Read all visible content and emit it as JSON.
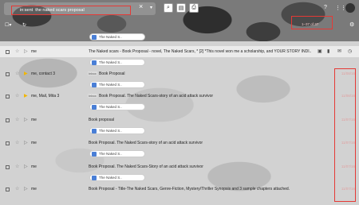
{
  "search": {
    "value": "in:sent  the naked scars proposal",
    "clear_icon": "close-icon",
    "caret_icon": "chevron-down-icon",
    "search_icon": "search-icon",
    "tools": [
      "search-icon",
      "document-icon",
      "print-icon"
    ]
  },
  "header": {
    "icons": [
      "help-icon",
      "apps-grid-icon"
    ]
  },
  "toolbar": {
    "count_text": "1–37 of 37",
    "settings_icon": "gear-icon"
  },
  "attachments": [
    "The Naked S..",
    "The Naked S..",
    "The Naked S..",
    "The Naked S..",
    "The Naked S..",
    "The Naked S..",
    "The Naked S.."
  ],
  "rows": [
    {
      "sender": "me",
      "tag": "",
      "subject": "The Naked scars - Book Proposal - novel, The Naked Scars, * [2] *This novel won me a scholarship, and YOUR STORY INDI..",
      "date": ""
    },
    {
      "sender": "me, contact 3",
      "tag": "Inbox",
      "subject": "Book Proposal",
      "date": "11/08/16"
    },
    {
      "sender": "me, Mail, Mita 3",
      "tag": "Inbox",
      "subject": "Book Proposal. The Naked Scars-story of an acid attack survivor",
      "date": "11/08/16"
    },
    {
      "sender": "me",
      "tag": "",
      "subject": "Book proposal",
      "date": "11/07/16"
    },
    {
      "sender": "me",
      "tag": "",
      "subject": "Book Proposal. The Naked Scars-story of an acid attack survivor",
      "date": "11/07/16"
    },
    {
      "sender": "me",
      "tag": "",
      "subject": "Book Proposal. The Naked Scars-Story of an acid attack survivor",
      "date": "11/07/16"
    },
    {
      "sender": "me",
      "tag": "",
      "subject": "Book Proposal - Title-The Naked Scars, Genre-Fiction, Mystery/Thriller Synopsis and 3 sample chapters attached.",
      "date": "11/07/16"
    }
  ],
  "colors": {
    "highlight_border": "#e53935",
    "attachment_icon": "#4a7fd6",
    "important_star": "#f2b600"
  }
}
